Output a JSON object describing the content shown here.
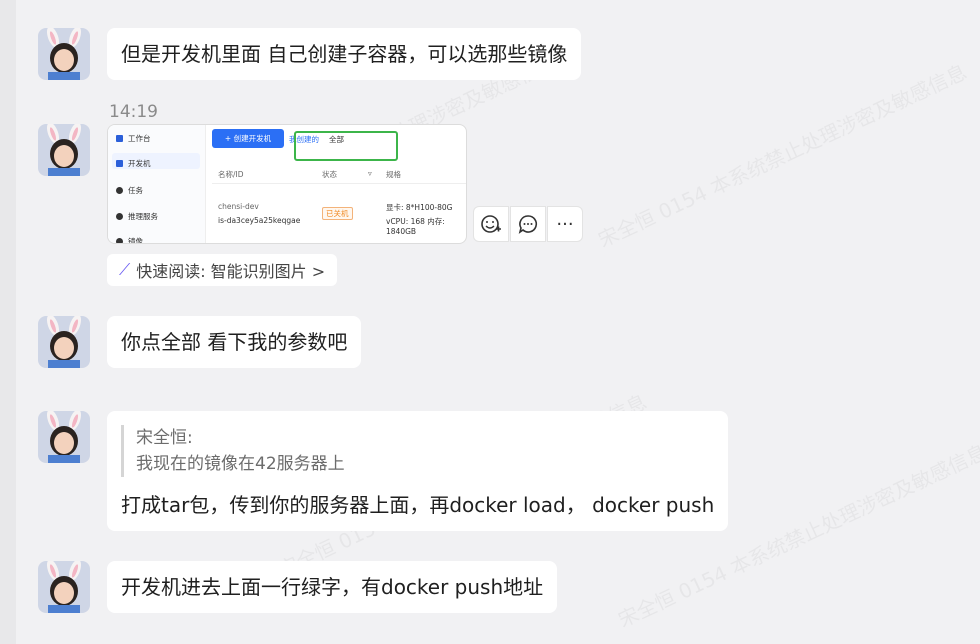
{
  "watermark": "宋全恒 0154 本系统禁止处理涉密及敏感信息",
  "messages": [
    {
      "text": "但是开发机里面 自己创建子容器，可以选那些镜像"
    },
    {
      "timestamp": "14:19",
      "screenshot": {
        "sidebar": [
          "工作台",
          "开发机",
          "任务",
          "推理服务",
          "镜像"
        ],
        "new_button": "+ 创建开发机",
        "filter_mine": "我创建的",
        "filter_all": "全部",
        "columns": [
          "名称/ID",
          "状态",
          "规格"
        ],
        "row": {
          "name": "chensi-dev",
          "id": "is-da3cey5a25keqgae",
          "status": "已关机",
          "gpu": "显卡: 8*H100-80G",
          "spec": "vCPU: 168 内存: 1840GB"
        }
      },
      "quick_read": "快速阅读: 智能识别图片 >"
    },
    {
      "text": "你点全部 看下我的参数吧"
    },
    {
      "quote_author": "宋全恒:",
      "quote_text": "我现在的镜像在42服务器上",
      "text": "打成tar包，传到你的服务器上面，再docker load， docker push"
    },
    {
      "text": "开发机进去上面一行绿字，有docker push地址"
    }
  ],
  "actions": [
    "emoji-add-icon",
    "comment-icon",
    "more-icon"
  ]
}
